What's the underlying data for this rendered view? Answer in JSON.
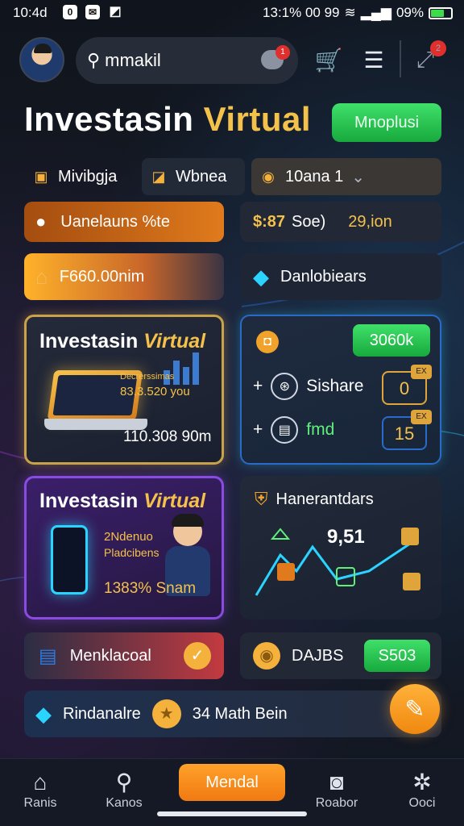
{
  "status_bar": {
    "time": "10:4d",
    "right_text": "13:1% 00 99",
    "battery_pct": "09%"
  },
  "header": {
    "search_text": "mmakil",
    "chat_badge": "1",
    "menu_badge": "2"
  },
  "hero": {
    "title_main": "Investasin",
    "title_accent": "Virtual",
    "button_label": "Mnoplusi"
  },
  "chips": [
    {
      "label": "Mivibgja",
      "icon": "briefcase-icon"
    },
    {
      "label": "Wbnea",
      "icon": "chart-icon"
    },
    {
      "label": "10ana 1",
      "icon": "coin-icon"
    }
  ],
  "row1": {
    "left_label": "Uanelauns %te",
    "right_value_a": "$:87",
    "right_value_b": "Soe)",
    "right_value_c": "29,ion"
  },
  "row2": {
    "left_label": "F660.00nim",
    "right_label": "Danlobiears"
  },
  "card1": {
    "title_main": "Investasin",
    "title_accent": "Virtual",
    "stat_small": "Decrerssimas",
    "stat_big": "83.3.520 you",
    "footer": "110.308 90m"
  },
  "card2": {
    "badge_label": "3060k",
    "item1_label": "Sishare",
    "item1_tag": "0",
    "item2_label": "fmd",
    "item2_tag": "15",
    "tag_text": "EX"
  },
  "card3": {
    "title_main": "Investasin",
    "title_accent": "Virtual",
    "sub1": "2Ndenuo",
    "sub2": "Pladcibens",
    "footer": "1383% Snam"
  },
  "card4": {
    "title": "Hanerantdars",
    "value": "9,51"
  },
  "row5": {
    "left_label": "Menklacoal",
    "right_label": "DAJBS",
    "right_button": "S503"
  },
  "row6": {
    "left_label": "Rindanalre",
    "right_label": "34 Math Bein"
  },
  "nav": {
    "items": [
      "Ranis",
      "Kanos",
      "Roabor",
      "Ooci"
    ],
    "center_label": "Mendal"
  },
  "colors": {
    "accent_gold": "#f4c14b",
    "accent_green": "#22c44c",
    "accent_orange": "#f08a14",
    "accent_purple": "#7c3bd6",
    "accent_cyan": "#2bd4ff"
  }
}
